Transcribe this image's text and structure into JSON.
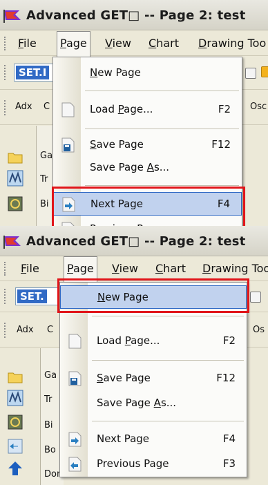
{
  "window": {
    "title": "Advanced GET□  -- Page 2: test"
  },
  "menubar": [
    {
      "label": "File",
      "accel": "F"
    },
    {
      "label": "Page",
      "accel": "P"
    },
    {
      "label": "View",
      "accel": "V"
    },
    {
      "label": "Chart",
      "accel": "C"
    },
    {
      "label": "Drawing Too",
      "accel": "D"
    }
  ],
  "toolbar1": {
    "symbol": "SET.I",
    "symbol2": "SET."
  },
  "toolbar2": {
    "adx": "Adx",
    "c": "C",
    "osc": "Osc",
    "os": "Os"
  },
  "leftpanel": {
    "items": [
      "Ga",
      "Tr",
      "Bi",
      "Bo",
      "Don"
    ]
  },
  "page_menu": {
    "items": [
      {
        "label": "New Page",
        "accel": "N",
        "shortcut": ""
      },
      {
        "label": "Load Page...",
        "accel": "P",
        "shortcut": "F2"
      },
      {
        "label": "Save Page",
        "accel": "S",
        "shortcut": "F12"
      },
      {
        "label": "Save Page As...",
        "accel": "A",
        "shortcut": ""
      },
      {
        "label": "Next Page",
        "accel": "",
        "shortcut": "F4"
      },
      {
        "label": "Previous Page",
        "accel": "",
        "shortcut": "F3"
      }
    ]
  },
  "highlight": {
    "top_panel": "Next Page",
    "bottom_panel": "New Page",
    "color": "#e1151a"
  }
}
